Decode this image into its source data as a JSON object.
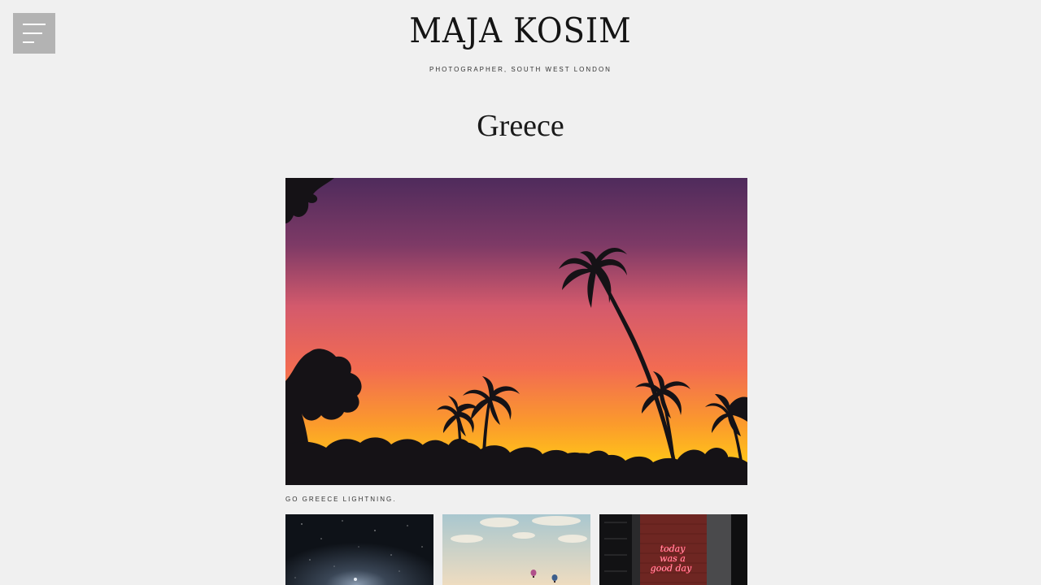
{
  "header": {
    "site_title": "MAJA KOSIM",
    "tagline": "PHOTOGRAPHER, SOUTH WEST LONDON",
    "menu_icon": "hamburger-menu-icon",
    "menu_button_color": "#b3b3b3"
  },
  "page": {
    "title": "Greece",
    "background_color": "#f0f0f0"
  },
  "gallery": {
    "hero": {
      "subject": "palm trees silhouetted against sunset",
      "caption": "GO GREECE LIGHTNING."
    },
    "thumbnails": [
      {
        "subject": "starry night sky"
      },
      {
        "subject": "hot air balloons in cloudy sky"
      },
      {
        "subject": "neon sign on brick wall",
        "sign_text": "today was a good day"
      }
    ]
  }
}
